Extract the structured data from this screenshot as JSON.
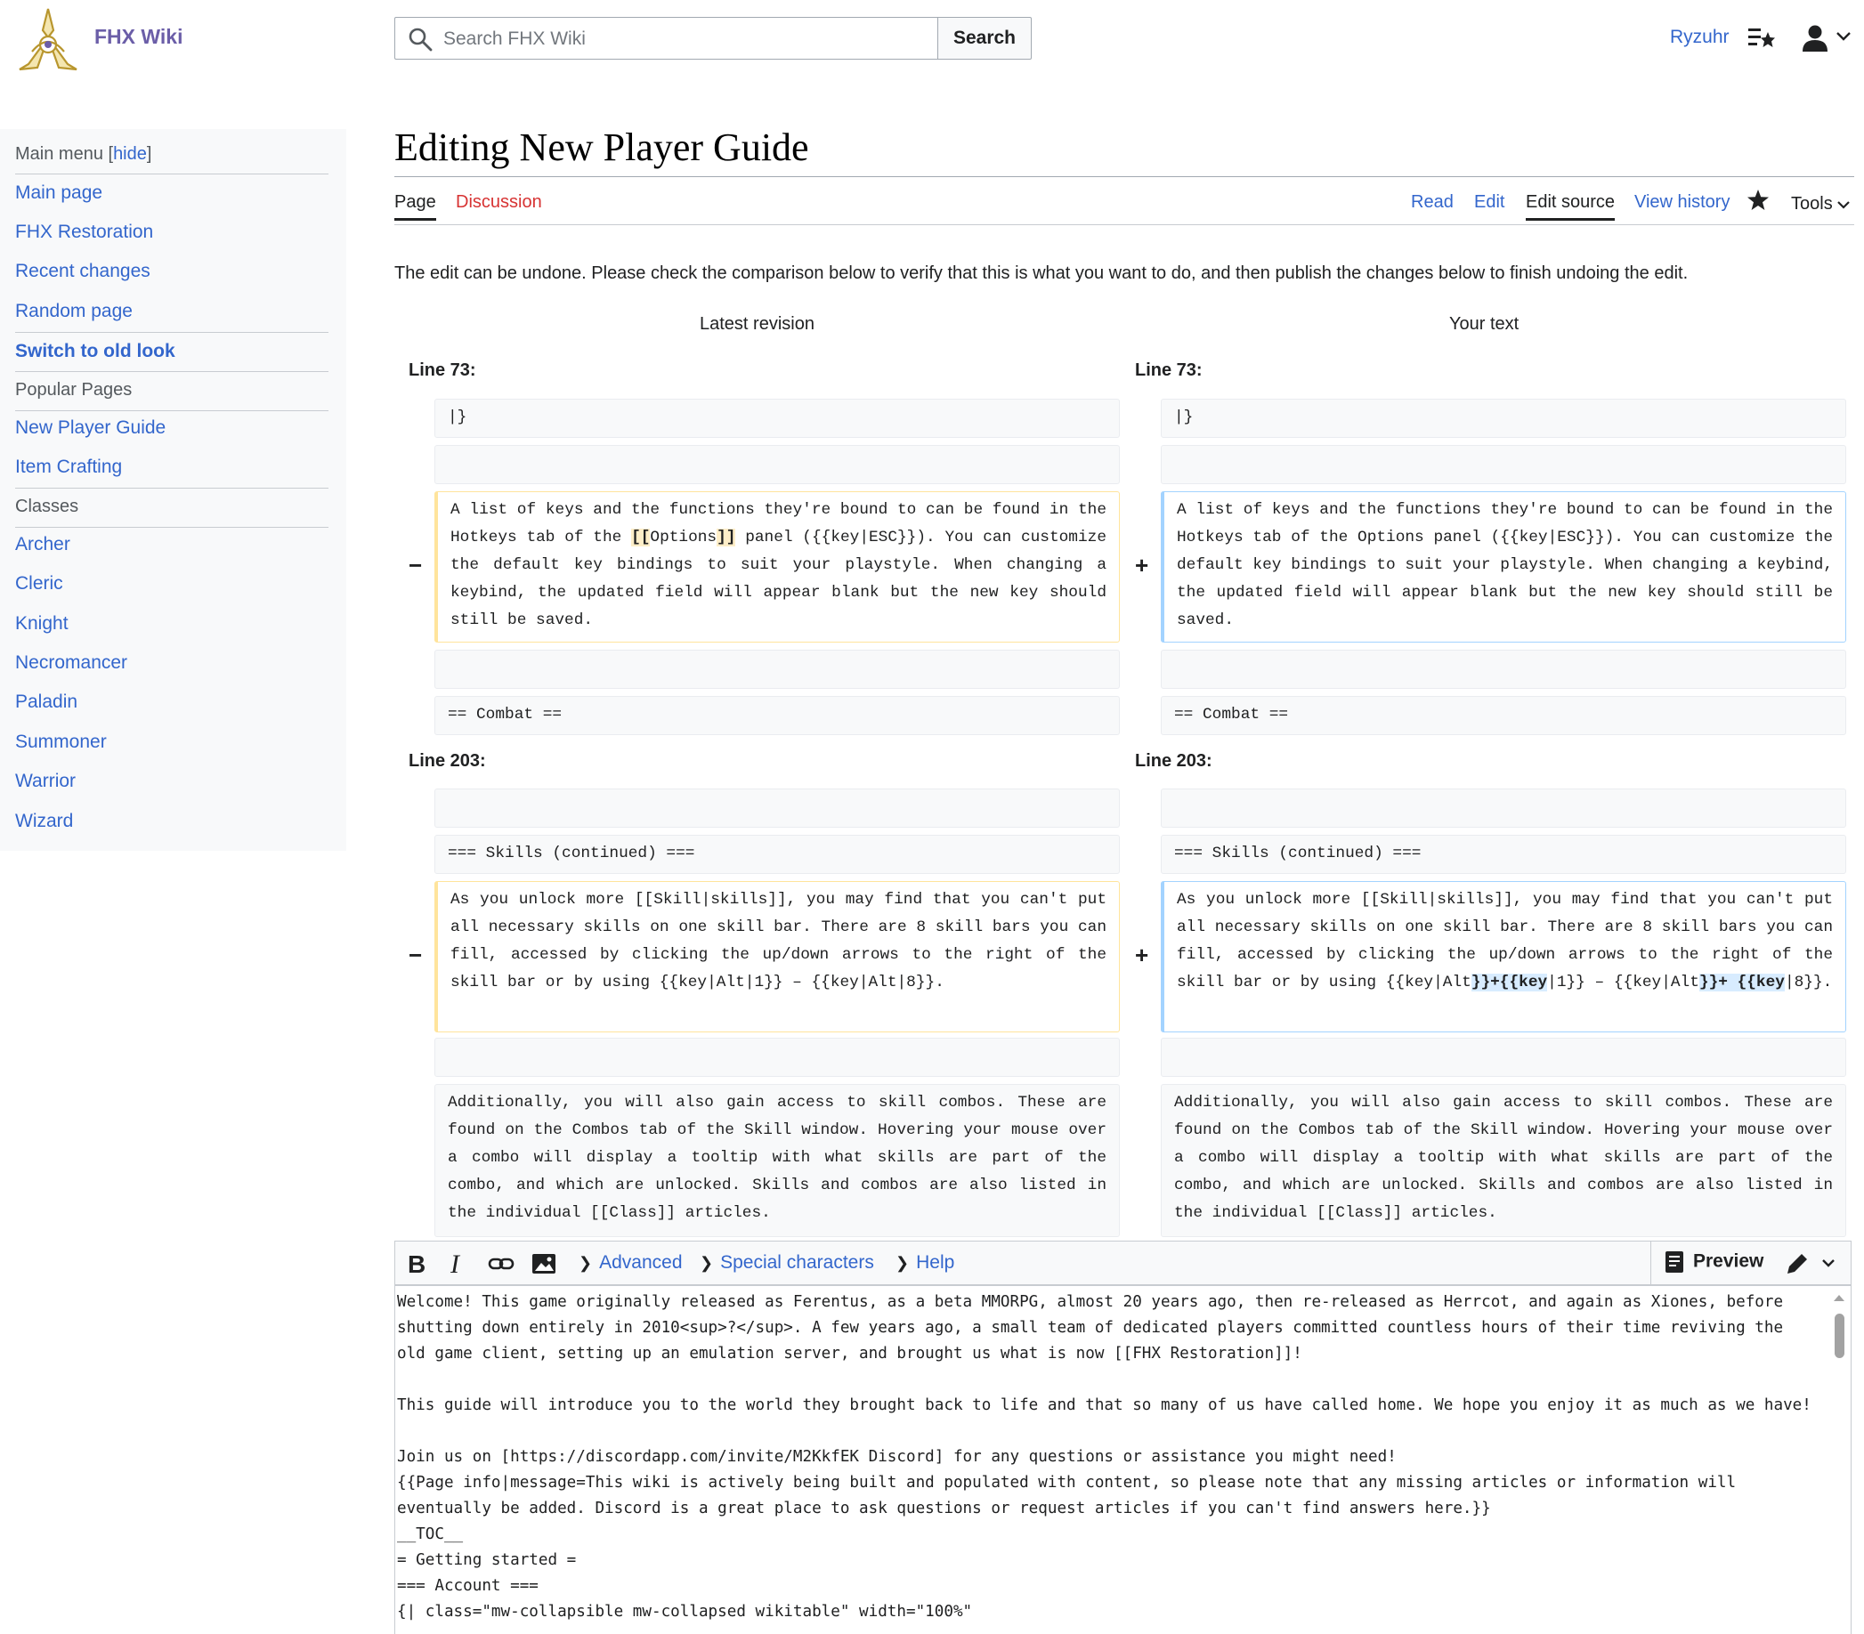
{
  "header": {
    "site_name": "FHX Wiki",
    "search_placeholder": "Search FHX Wiki",
    "search_button": "Search",
    "user_name": "Ryzuhr",
    "icons": [
      "wiki-logo-icon",
      "search-icon",
      "watchlist-icon",
      "user-icon",
      "chevron-down-icon"
    ]
  },
  "sidebar": {
    "title": "Main menu",
    "hide_label": "hide",
    "items": [
      {
        "label": "Main page"
      },
      {
        "label": "FHX Restoration"
      },
      {
        "label": "Recent changes"
      },
      {
        "label": "Random page"
      },
      {
        "label": "Switch to old look"
      }
    ],
    "popular_heading": "Popular Pages",
    "popular_items": [
      {
        "label": "New Player Guide"
      },
      {
        "label": "Item Crafting"
      }
    ],
    "classes_heading": "Classes",
    "classes_items": [
      {
        "label": "Archer"
      },
      {
        "label": "Cleric"
      },
      {
        "label": "Knight"
      },
      {
        "label": "Necromancer"
      },
      {
        "label": "Paladin"
      },
      {
        "label": "Summoner"
      },
      {
        "label": "Warrior"
      },
      {
        "label": "Wizard"
      }
    ]
  },
  "page": {
    "title": "Editing New Player Guide",
    "tabs_left": [
      "Page",
      "Discussion"
    ],
    "tabs_right": [
      "Read",
      "Edit",
      "Edit source",
      "View history"
    ],
    "tools_label": "Tools",
    "notice": "The edit can be undone. Please check the comparison below to verify that this is what you want to do, and then publish the changes below to finish undoing the edit."
  },
  "diff": {
    "left_header": "Latest revision",
    "right_header": "Your text",
    "hunk1_label_left": "Line 73:",
    "hunk1_label_right": "Line 73:",
    "hunk2_label_left": "Line 203:",
    "hunk2_label_right": "Line 203:",
    "minus": "−",
    "plus": "+",
    "ctx_table_end": "|}",
    "ctx_combat": "== Combat ==",
    "ctx_skills_heading": "=== Skills (continued) ===",
    "keys_del_a": "A list of keys and the functions they're bound to can be found in the Hotkeys tab of the ",
    "keys_del_hl": "[[",
    "keys_del_b": "Options",
    "keys_del_hl2": "]]",
    "keys_del_c": " panel ({{key|ESC}}). You can customize the default key bindings to suit your playstyle. When changing a keybind, the updated field will appear blank but the new key should still be saved.",
    "keys_add": "A list of keys and the functions they're bound to can be found in the Hotkeys tab of the Options panel ({{key|ESC}}). You can customize the default key bindings to suit your playstyle. When changing a keybind, the updated field will appear blank but the new key should still be saved.",
    "skills_del": "As you unlock more [[Skill|skills]], you may find that you can't put all necessary skills on one skill bar. There are 8 skill bars you can fill, accessed by clicking the up/down arrows to the right of the skill bar or by using {{key|Alt|1}} – {{key|Alt|8}}.",
    "skills_add_a": "As you unlock more [[Skill|skills]], you may find that you can't put all necessary skills on one skill bar. There are 8 skill bars you can fill, accessed by clicking the up/down arrows to the right of the skill bar or by using {{key|Alt",
    "skills_add_hl1": "}}+{{key",
    "skills_add_b": "|1}} – {{key|Alt",
    "skills_add_hl2": "}}+ {{key",
    "skills_add_c": "|8}}.",
    "ctx_combos": "Additionally, you will also gain access to skill combos. These are found on the Combos tab of the Skill window. Hovering your mouse over a combo will display a tooltip with what skills are part of the combo, and which are unlocked. Skills and combos are also listed in the individual [[Class]] articles."
  },
  "editor": {
    "toolbar_groups": [
      "Advanced",
      "Special characters",
      "Help"
    ],
    "preview_label": "Preview",
    "icons": [
      "bold-icon",
      "italic-icon",
      "link-icon",
      "image-icon",
      "preview-icon",
      "pencil-icon"
    ],
    "lines": [
      "Welcome! This game originally released as Ferentus, as a beta MMORPG, almost 20 years ago, then re-released as Herrcot, and again as Xiones, before",
      "shutting down entirely in 2010<sup>?</sup>. A few years ago, a small team of dedicated players committed countless hours of their time reviving the",
      "old game client, setting up an emulation server, and brought us what is now [[FHX Restoration]]!",
      "",
      "This guide will introduce you to the world they brought back to life and that so many of us have called home. We hope you enjoy it as much as we have!",
      "",
      "Join us on [https://discordapp.com/invite/M2KkfEK Discord] for any questions or assistance you might need!",
      "{{Page info|message=This wiki is actively being built and populated with content, so please note that any missing articles or information will",
      "eventually be added. Discord is a great place to ask questions or request articles if you can't find answers here.}}",
      "__TOC__",
      "= Getting started =",
      "=== Account ===",
      "{| class=\"mw-collapsible mw-collapsed wikitable\" width=\"100%\""
    ]
  },
  "colors": {
    "link": "#3366cc",
    "redlink": "#d73333",
    "site_name": "#6b5ea8",
    "deleted_border": "#ffe49c",
    "added_border": "#a3d3ff",
    "deleted_highlight": "#feeec8",
    "added_highlight": "#d8ecff"
  }
}
